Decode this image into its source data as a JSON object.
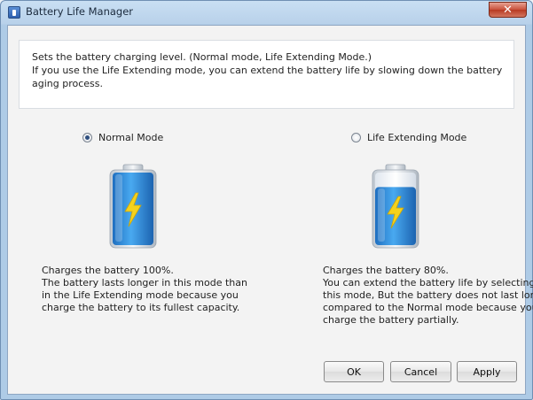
{
  "window": {
    "title": "Battery Life Manager",
    "close_glyph": "✕"
  },
  "info": {
    "line1": "Sets the battery charging level. (Normal mode, Life Extending Mode.)",
    "line2": "If you use the Life Extending mode, you can extend the battery life by slowing down the battery",
    "line3": "aging process."
  },
  "modes": {
    "normal": {
      "label": "Normal Mode",
      "selected": true,
      "charge_percent": 100,
      "desc": [
        "Charges the battery 100%.",
        "The battery lasts longer in this mode than",
        "in the Life Extending mode because you",
        "charge the battery to its fullest capacity."
      ]
    },
    "life_extending": {
      "label": "Life Extending Mode",
      "selected": false,
      "charge_percent": 80,
      "desc": [
        "Charges the battery 80%.",
        "You can extend the battery life by selecting",
        "this mode, But the battery does not last long",
        "compared to the Normal mode because you",
        "charge the battery partially."
      ]
    }
  },
  "buttons": {
    "ok": "OK",
    "cancel": "Cancel",
    "apply": "Apply"
  },
  "colors": {
    "battery_fill": "#2f8fe0",
    "bolt": "#f5d21c"
  }
}
